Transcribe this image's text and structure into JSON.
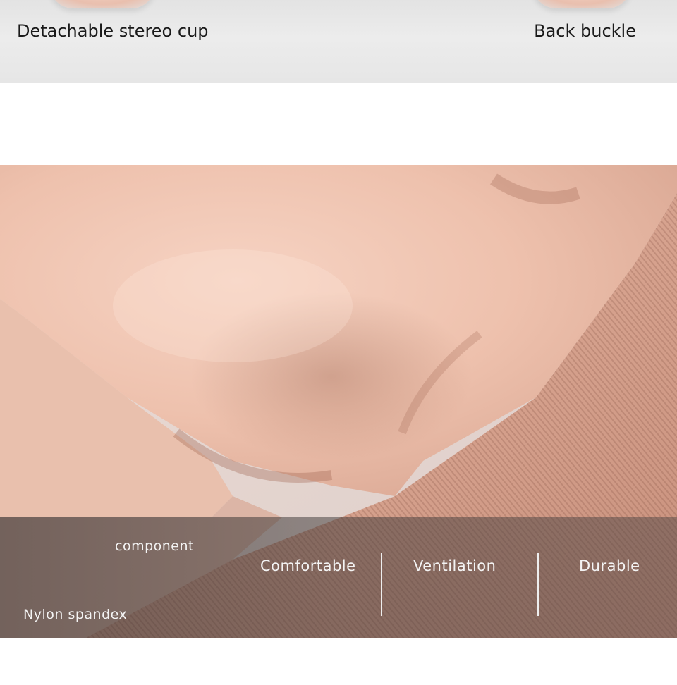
{
  "top_features": {
    "left_label": "Detachable stereo cup",
    "right_label": "Back buckle"
  },
  "composition": {
    "heading": "component",
    "material": "Nylon spandex"
  },
  "features": [
    "Comfortable",
    "Ventilation",
    "Durable"
  ],
  "colors": {
    "fabric": "#efc4b1",
    "fabric_shadow": "#d9a58f",
    "band": "#3a3535",
    "top_strip": "#e8e8e8"
  }
}
